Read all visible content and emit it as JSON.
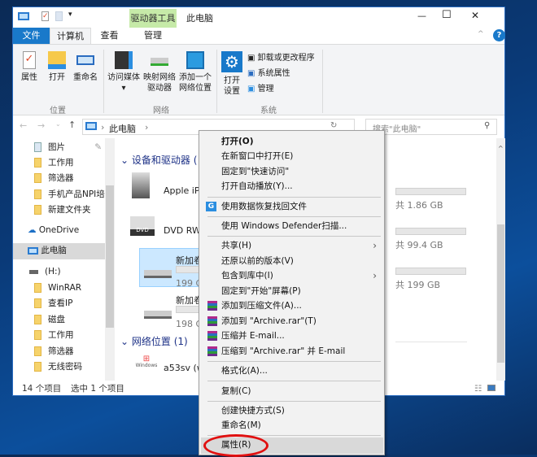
{
  "window": {
    "title": "此电脑",
    "context_tab": "驱动器工具",
    "controls": {
      "minimize": "—",
      "maximize": "☐",
      "close": "✕"
    }
  },
  "tabs": [
    {
      "label": "文件",
      "active": false,
      "file": true
    },
    {
      "label": "计算机",
      "active": true
    },
    {
      "label": "查看"
    },
    {
      "label": "管理"
    }
  ],
  "ribbon": {
    "groups": [
      {
        "label": "位置",
        "buttons": [
          "属性",
          "打开",
          "重命名"
        ]
      },
      {
        "label": "网络",
        "buttons": [
          "访问媒体",
          "映射网络\n驱动器",
          "添加一个\n网络位置"
        ]
      },
      {
        "label": "系统",
        "buttons": [
          "打开\n设置"
        ],
        "small": [
          "卸载或更改程序",
          "系统属性",
          "管理"
        ]
      }
    ]
  },
  "address": {
    "path": "此电脑",
    "search_placeholder": "搜索\"此电脑\""
  },
  "nav": {
    "items": [
      "图片",
      "工作用",
      "筛选器",
      "手机产品NPI培训",
      "新建文件夹",
      "OneDrive",
      "此电脑",
      "(H:)",
      "WinRAR",
      "查看IP",
      "磁盘",
      "工作用",
      "筛选器",
      "无线密码"
    ],
    "selected": "此电脑"
  },
  "content": {
    "devices_header": "设备和驱动器 (",
    "drives": [
      {
        "name": "Apple iPh",
        "size": "共 1.86 GB"
      },
      {
        "name": "DVD RW",
        "size": "共 99.4 GB"
      },
      {
        "name": "新加卷 (D",
        "free": "199 GB 可",
        "size": "共 199 GB",
        "selected": true
      },
      {
        "name": "新加卷 (G",
        "free": "198 GB 可"
      }
    ],
    "network_header": "网络位置 (1)",
    "network": [
      {
        "name": "a53sv (wl"
      }
    ],
    "wmp_logo": "Windows Media Player"
  },
  "status": {
    "count": "14 个项目",
    "selected": "选中 1 个项目"
  },
  "context_menu": {
    "items": [
      "打开(O)",
      "在新窗口中打开(E)",
      "固定到\"快速访问\"",
      "打开自动播放(Y)...",
      "使用数据恢复找回文件",
      "使用 Windows Defender扫描...",
      "共享(H)",
      "还原以前的版本(V)",
      "包含到库中(I)",
      "固定到\"开始\"屏幕(P)",
      "添加到压缩文件(A)...",
      "添加到 \"Archive.rar\"(T)",
      "压缩并 E-mail...",
      "压缩到 \"Archive.rar\" 并 E-mail",
      "格式化(A)...",
      "复制(C)",
      "创建快捷方式(S)",
      "重命名(M)",
      "属性(R)"
    ],
    "highlighted": "属性(R)"
  },
  "colors": {
    "accent": "#1979ca",
    "selection": "#cce8ff",
    "highlight_circle": "#e01010",
    "drive_tools": "#c6eaa8"
  }
}
